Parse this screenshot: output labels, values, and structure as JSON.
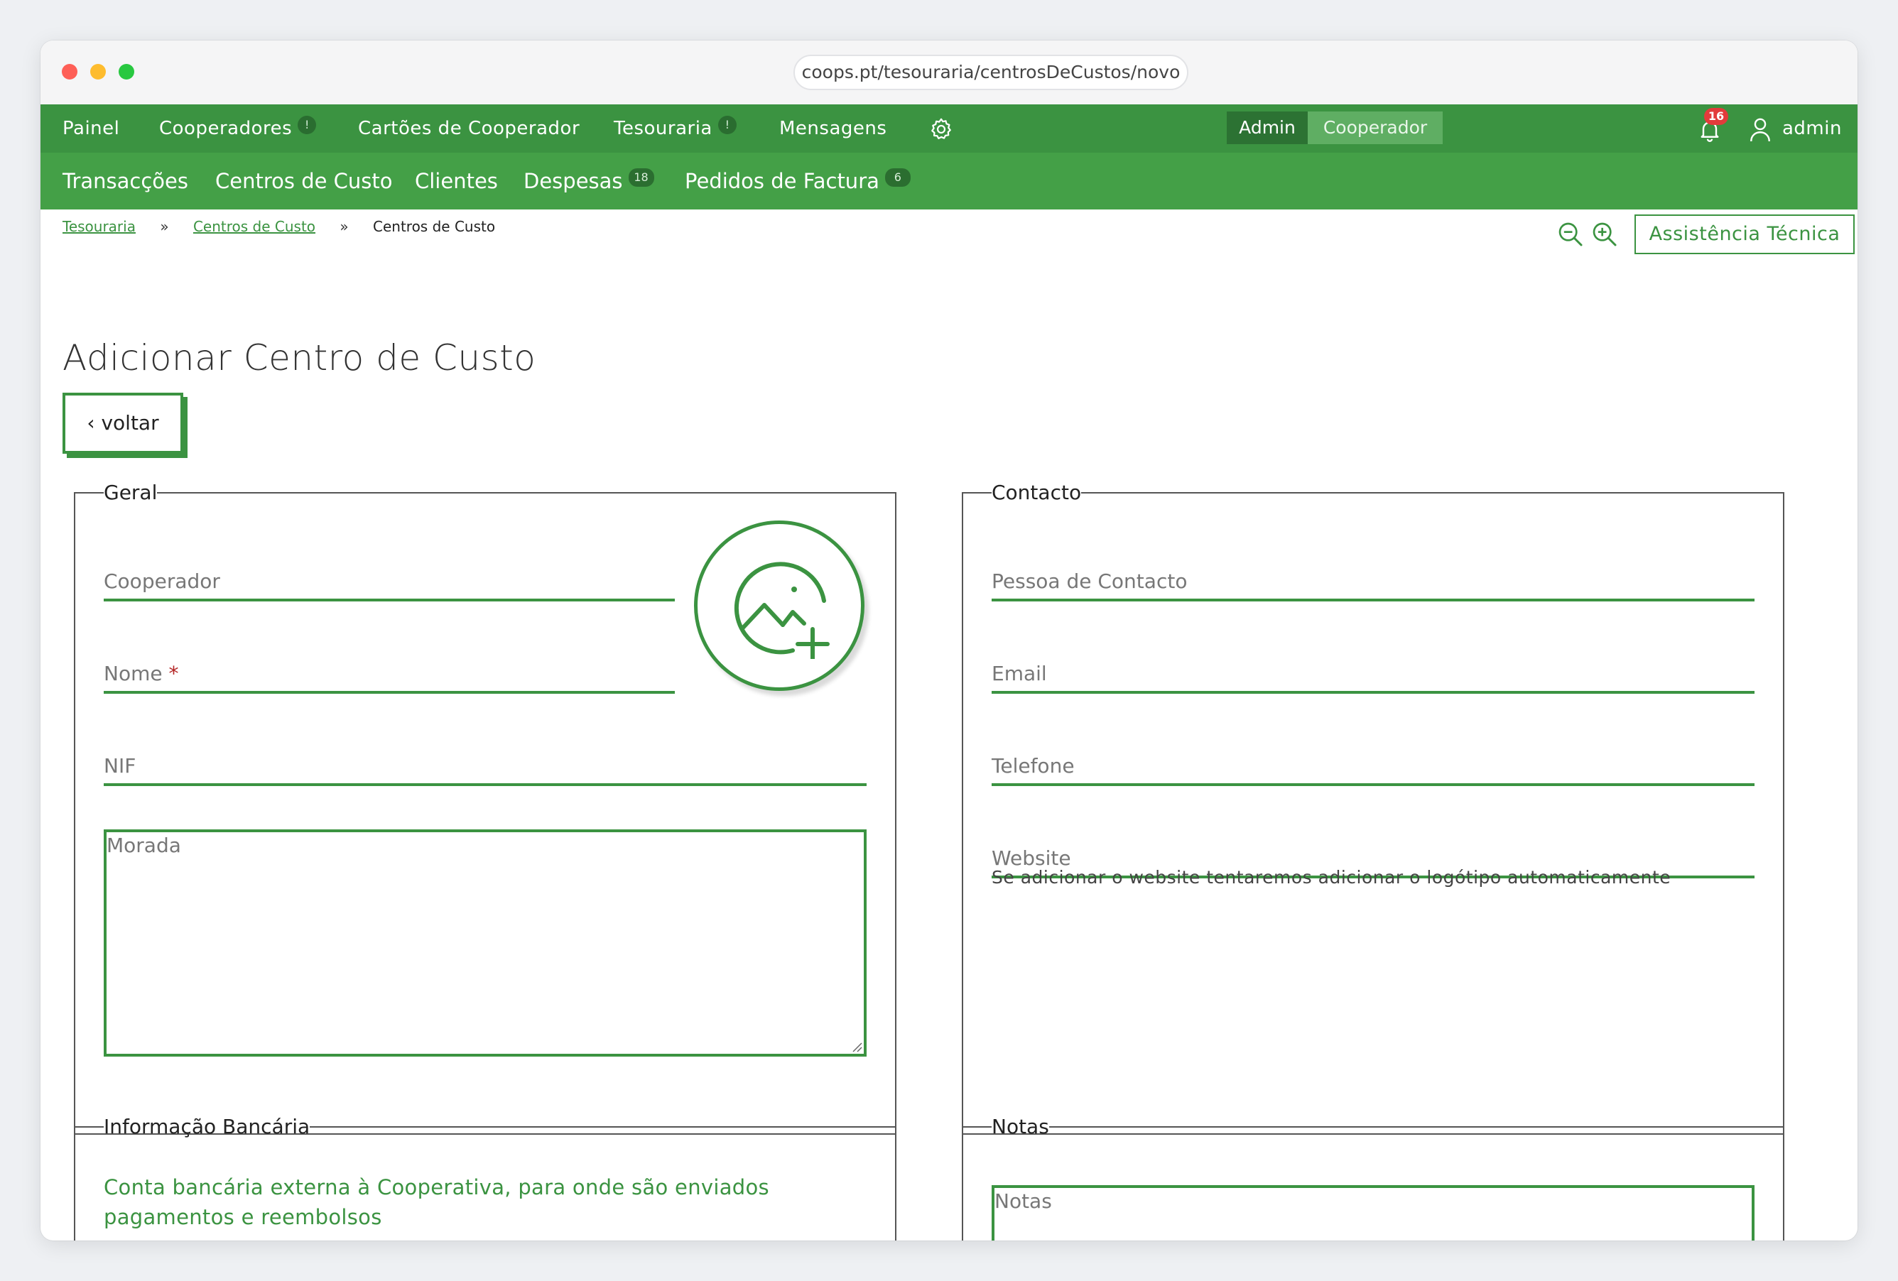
{
  "browser": {
    "url": "coops.pt/tesouraria/centrosDeCustos/novo"
  },
  "topnav": {
    "items": [
      {
        "label": "Painel"
      },
      {
        "label": "Cooperadores",
        "badge": "!"
      },
      {
        "label": "Cartões de Cooperador"
      },
      {
        "label": "Tesouraria",
        "badge": "!"
      },
      {
        "label": "Mensagens"
      }
    ],
    "role_switch": {
      "admin": "Admin",
      "cooperador": "Cooperador",
      "active": "Admin"
    },
    "notifications_count": "16",
    "user": "admin"
  },
  "subnav": {
    "items": [
      {
        "label": "Transacções"
      },
      {
        "label": "Centros de Custo"
      },
      {
        "label": "Clientes"
      },
      {
        "label": "Despesas",
        "count": "18"
      },
      {
        "label": "Pedidos de Factura",
        "count": "6"
      }
    ]
  },
  "breadcrumb": {
    "items": [
      "Tesouraria",
      "Centros de Custo"
    ],
    "current": "Centros de Custo",
    "separator": "»"
  },
  "help_button": "Assistência Técnica",
  "page_title": "Adicionar Centro de Custo",
  "back_button": "‹ voltar",
  "geral": {
    "legend": "Geral",
    "cooperador_label": "Cooperador",
    "nome_label": "Nome",
    "required_mark": "*",
    "nif_label": "NIF",
    "morada_label": "Morada"
  },
  "contacto": {
    "legend": "Contacto",
    "pessoa_label": "Pessoa de Contacto",
    "email_label": "Email",
    "telefone_label": "Telefone",
    "website_label": "Website",
    "website_hint": "Se adicionar o website tentaremos adicionar o logótipo automaticamente"
  },
  "bancaria": {
    "legend": "Informação Bancária",
    "description": "Conta bancária externa à Cooperativa, para onde são enviados pagamentos e reembolsos"
  },
  "notas": {
    "legend": "Notas",
    "notas_label": "Notas"
  },
  "colors": {
    "brand_green": "#3b9341",
    "subnav_green": "#44a047",
    "badge_red": "#e23b3b"
  },
  "icons": [
    "gear-icon",
    "bell-icon",
    "user-icon",
    "zoom-out-icon",
    "zoom-in-icon",
    "add-image-icon",
    "resize-grip-icon"
  ]
}
